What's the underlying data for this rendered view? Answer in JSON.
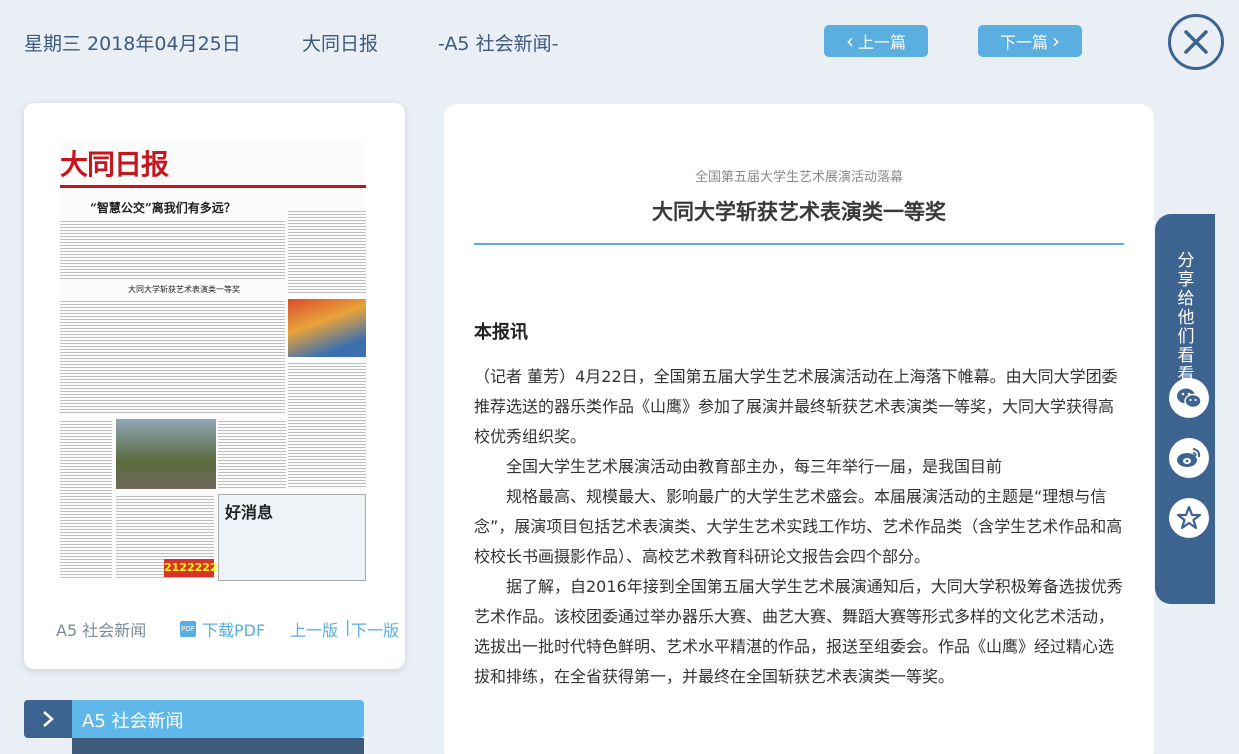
{
  "header": {
    "date": "星期三 2018年04月25日",
    "paper_name": "大同日报",
    "section": "-A5 社会新闻-",
    "prev_label": "上一篇",
    "next_label": "下一篇"
  },
  "newspaper_page": {
    "masthead": "大同日报",
    "headline_1": "“智慧公交”离我们有多远？",
    "headline_2": "大同大学斩获艺术表演类一等奖",
    "ad_title": "好消息",
    "ad_number": "2122222",
    "page_label": "A5 社会新闻",
    "download_pdf": "下载PDF",
    "prev_page": "上一版",
    "separator": "|",
    "next_page": "下一版"
  },
  "section_list": {
    "current": "A5  社会新闻"
  },
  "article": {
    "kicker": "全国第五届大学生艺术展演活动落幕",
    "title": "大同大学斩获艺术表演类一等奖",
    "byline": "本报讯",
    "paragraph_1": "（记者 董芳）4月22日，全国第五届大学生艺术展演活动在上海落下帷幕。由大同大学团委推荐选送的器乐类作品《山鹰》参加了展演并最终斩获艺术表演类一等奖，大同大学获得高校优秀组织奖。",
    "paragraph_2": "全国大学生艺术展演活动由教育部主办，每三年举行一届，是我国目前",
    "paragraph_3": "规格最高、规模最大、影响最广的大学生艺术盛会。本届展演活动的主题是“理想与信念”，展演项目包括艺术表演类、大学生艺术实践工作坊、艺术作品类（含学生艺术作品和高校校长书画摄影作品）、高校艺术教育科研论文报告会四个部分。",
    "paragraph_4": "据了解，自2016年接到全国第五届大学生艺术展演通知后，大同大学积极筹备选拔优秀艺术作品。该校团委通过举办器乐大赛、曲艺大赛、舞蹈大赛等形式多样的文化艺术活动，选拔出一批时代特色鲜明、艺术水平精湛的作品，报送至组委会。作品《山鹰》经过精心选拔和排练，在全省获得第一，并最终在全国斩获艺术表演类一等奖。"
  },
  "share": {
    "title": "分享给他们看看",
    "icons": [
      "wechat-icon",
      "weibo-icon",
      "favorite-icon"
    ]
  },
  "colors": {
    "accent": "#5aaee0",
    "dark_blue": "#3d6391",
    "background": "#e9eff5"
  }
}
